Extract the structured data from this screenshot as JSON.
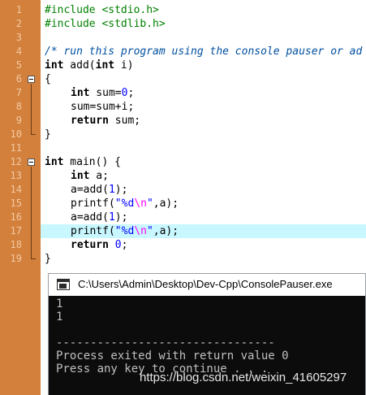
{
  "editor": {
    "line_numbers": [
      "1",
      "2",
      "3",
      "4",
      "5",
      "6",
      "7",
      "8",
      "9",
      "10",
      "11",
      "12",
      "13",
      "14",
      "15",
      "16",
      "17",
      "18",
      "19"
    ],
    "lines": {
      "l1": {
        "pp": "#include <stdio.h>"
      },
      "l2": {
        "pp": "#include <stdlib.h>"
      },
      "l4": {
        "comment": "/* run this program using the console pauser or ad"
      },
      "l5": {
        "kw": "int",
        "rest": " add(",
        "kw2": "int",
        "rest2": " i)"
      },
      "l6": {
        "text": "{"
      },
      "l7": {
        "kw": "int",
        "rest": " sum=",
        "num": "0",
        "end": ";"
      },
      "l8": {
        "text": "sum=sum+i;"
      },
      "l9": {
        "kw": "return",
        "rest": " sum;"
      },
      "l10": {
        "text": "}"
      },
      "l12": {
        "kw": "int",
        "rest": " main() {"
      },
      "l13": {
        "kw": "int",
        "rest": " a;"
      },
      "l14": {
        "pre": "a=add(",
        "num": "1",
        "post": ");"
      },
      "l15": {
        "pre": "printf(",
        "str1": "\"%d",
        "esc": "\\n",
        "str2": "\"",
        "post": ",a);"
      },
      "l16": {
        "pre": "a=add(",
        "num": "1",
        "post": ");"
      },
      "l17": {
        "pre": "printf(",
        "str1": "\"%d",
        "esc": "\\n",
        "str2": "\"",
        "post": ",a);"
      },
      "l18": {
        "kw": "return",
        "rest": " ",
        "num": "0",
        "end": ";"
      },
      "l19": {
        "text": "}"
      }
    },
    "highlighted_line": "17"
  },
  "console": {
    "title": "C:\\Users\\Admin\\Desktop\\Dev-Cpp\\ConsolePauser.exe",
    "output": [
      "1",
      "1",
      "",
      "--------------------------------",
      "Process exited with return value 0",
      "Press any key to continue . . ."
    ]
  },
  "watermark": "https://blog.csdn.net/weixin_41605297",
  "colors": {
    "gutter": "#d2803b",
    "highlight": "#c8f7ff",
    "console_bg": "#0c0c0c",
    "console_text": "#c0c0c0"
  },
  "icons": [
    "fold-collapse-icon",
    "console-app-icon"
  ]
}
